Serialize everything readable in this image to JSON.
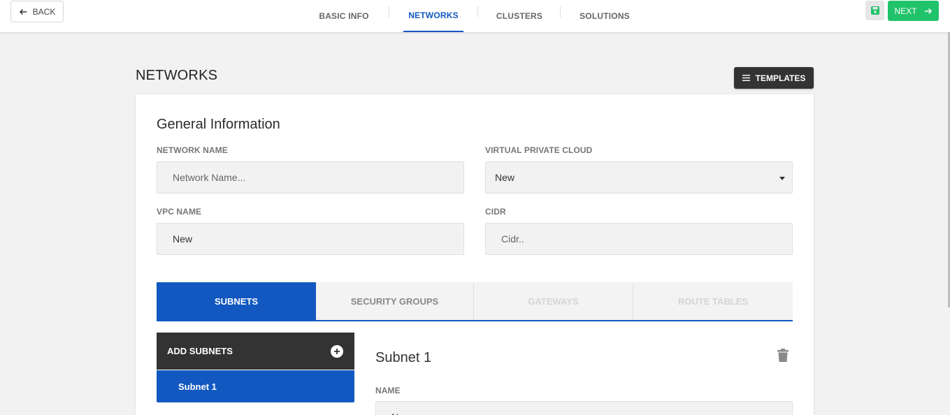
{
  "topbar": {
    "back_label": "BACK",
    "steps": [
      {
        "label": "BASIC INFO",
        "active": false
      },
      {
        "label": "NETWORKS",
        "active": true
      },
      {
        "label": "CLUSTERS",
        "active": false
      },
      {
        "label": "SOLUTIONS",
        "active": false
      }
    ],
    "next_label": "NEXT"
  },
  "colors": {
    "primary": "#1258c0",
    "success": "#21c36a",
    "dark": "#333333"
  },
  "page": {
    "title": "NETWORKS",
    "templates_label": "TEMPLATES"
  },
  "general": {
    "title": "General Information",
    "network_name": {
      "label": "NETWORK NAME",
      "placeholder": "Network Name...",
      "value": ""
    },
    "vpc": {
      "label": "VIRTUAL PRIVATE CLOUD",
      "selected": "New"
    },
    "vpc_name": {
      "label": "VPC NAME",
      "value": "New"
    },
    "cidr": {
      "label": "CIDR",
      "placeholder": "Cidr..",
      "value": ""
    }
  },
  "tabs": [
    {
      "label": "SUBNETS",
      "state": "active"
    },
    {
      "label": "SECURITY GROUPS",
      "state": "normal"
    },
    {
      "label": "GATEWAYS",
      "state": "disabled"
    },
    {
      "label": "ROUTE TABLES",
      "state": "disabled"
    }
  ],
  "subnets": {
    "add_label": "ADD SUBNETS",
    "items": [
      "Subnet 1"
    ],
    "detail_title": "Subnet 1",
    "name_label": "NAME",
    "name_value": "N"
  }
}
